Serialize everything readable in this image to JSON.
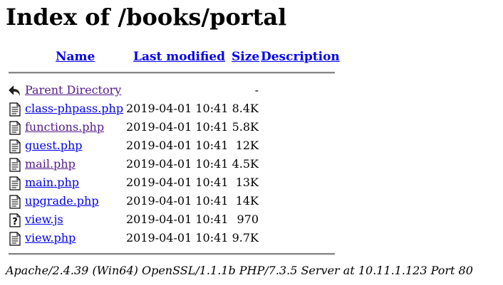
{
  "page": {
    "title": "Index of /books/portal"
  },
  "table": {
    "headers": {
      "name": "Name",
      "last_modified": "Last modified",
      "size": "Size",
      "description": "Description"
    },
    "parent": {
      "label": "Parent Directory",
      "size": "-",
      "icon": "back-arrow-icon"
    },
    "rows": [
      {
        "name": "class-phpass.php",
        "modified": "2019-04-01 10:41",
        "size": "8.4K",
        "icon": "text-file-icon",
        "visited": false
      },
      {
        "name": "functions.php",
        "modified": "2019-04-01 10:41",
        "size": "5.8K",
        "icon": "text-file-icon",
        "visited": true
      },
      {
        "name": "guest.php",
        "modified": "2019-04-01 10:41",
        "size": "12K",
        "icon": "text-file-icon",
        "visited": false
      },
      {
        "name": "mail.php",
        "modified": "2019-04-01 10:41",
        "size": "4.5K",
        "icon": "text-file-icon",
        "visited": true
      },
      {
        "name": "main.php",
        "modified": "2019-04-01 10:41",
        "size": "13K",
        "icon": "text-file-icon",
        "visited": false
      },
      {
        "name": "upgrade.php",
        "modified": "2019-04-01 10:41",
        "size": "14K",
        "icon": "text-file-icon",
        "visited": false
      },
      {
        "name": "view.js",
        "modified": "2019-04-01 10:41",
        "size": "970",
        "icon": "unknown-file-icon",
        "visited": false
      },
      {
        "name": "view.php",
        "modified": "2019-04-01 10:41",
        "size": "9.7K",
        "icon": "text-file-icon",
        "visited": false
      }
    ]
  },
  "footer": {
    "server_signature": "Apache/2.4.39 (Win64) OpenSSL/1.1.1b PHP/7.3.5 Server at 10.11.1.123 Port 80"
  },
  "colors": {
    "link": "#0000ee",
    "visited_link": "#551a8b",
    "rule": "#888888"
  }
}
